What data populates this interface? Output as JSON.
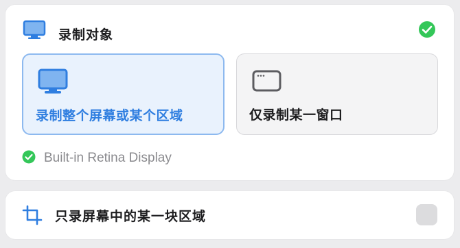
{
  "target": {
    "title": "录制对象",
    "options": [
      {
        "label": "录制整个屏幕或某个区域",
        "icon": "monitor-icon",
        "selected": true
      },
      {
        "label": "仅录制某一窗口",
        "icon": "window-icon",
        "selected": false
      }
    ],
    "display_name": "Built-in Retina Display",
    "status_icon": "check-circle-icon"
  },
  "area": {
    "label": "只录屏幕中的某一块区域",
    "icon": "crop-icon",
    "checked": false
  },
  "colors": {
    "accent": "#2f7ee0",
    "success": "#34c759",
    "selected_bg": "#e9f2fd"
  }
}
